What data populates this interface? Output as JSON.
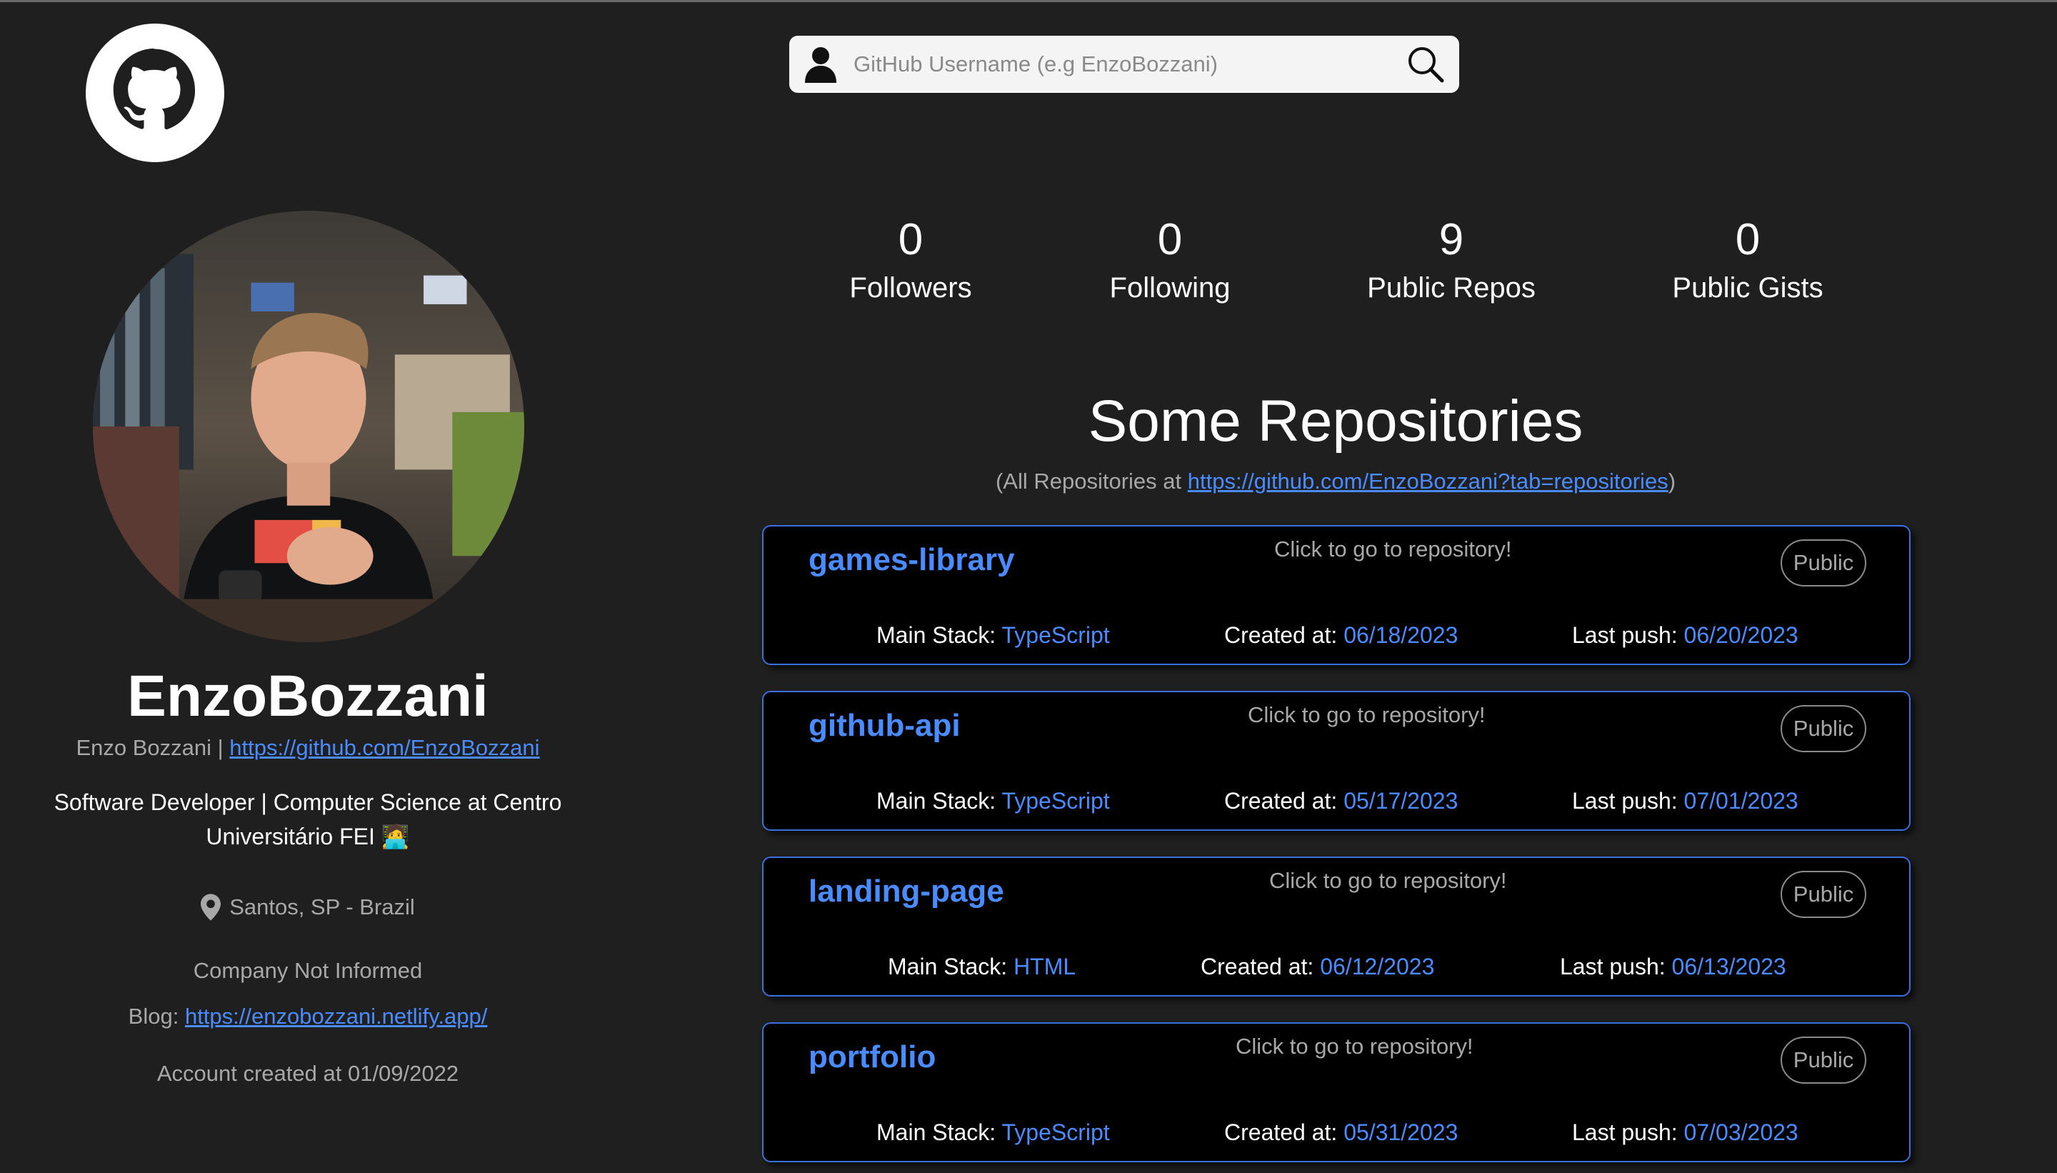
{
  "search": {
    "placeholder": "GitHub Username (e.g EnzoBozzani)"
  },
  "profile": {
    "username": "EnzoBozzani",
    "name": "Enzo Bozzani",
    "separator": " | ",
    "url": "https://github.com/EnzoBozzani",
    "bio": "Software Developer | Computer Science at Centro Universitário FEI",
    "bio_emoji": "🧑‍💻",
    "location": "Santos, SP - Brazil",
    "company": "Company Not Informed",
    "blog_label": "Blog: ",
    "blog_url": "https://enzobozzani.netlify.app/",
    "account_created": "Account created at 01/09/2022"
  },
  "stats": [
    {
      "value": "0",
      "label": "Followers"
    },
    {
      "value": "0",
      "label": "Following"
    },
    {
      "value": "9",
      "label": "Public Repos"
    },
    {
      "value": "0",
      "label": "Public Gists"
    }
  ],
  "repos_section": {
    "title": "Some Repositories",
    "all_prefix": "(All Repositories at ",
    "all_url": "https://github.com/EnzoBozzani?tab=repositories",
    "all_suffix": ")"
  },
  "repo_labels": {
    "hint": "Click to go to repository!",
    "badge": "Public",
    "stack": "Main Stack: ",
    "created": "Created at: ",
    "push": "Last push: "
  },
  "repos": [
    {
      "name": "games-library",
      "stack": "TypeScript",
      "created": "06/18/2023",
      "pushed": "06/20/2023"
    },
    {
      "name": "github-api",
      "stack": "TypeScript",
      "created": "05/17/2023",
      "pushed": "07/01/2023"
    },
    {
      "name": "landing-page",
      "stack": "HTML",
      "created": "06/12/2023",
      "pushed": "06/13/2023"
    },
    {
      "name": "portfolio",
      "stack": "TypeScript",
      "created": "05/31/2023",
      "pushed": "07/03/2023"
    }
  ],
  "colors": {
    "background": "#1f1f1f",
    "accent": "#4a8cff",
    "card_border": "#3a6fe0",
    "muted": "#a8a8a8"
  }
}
